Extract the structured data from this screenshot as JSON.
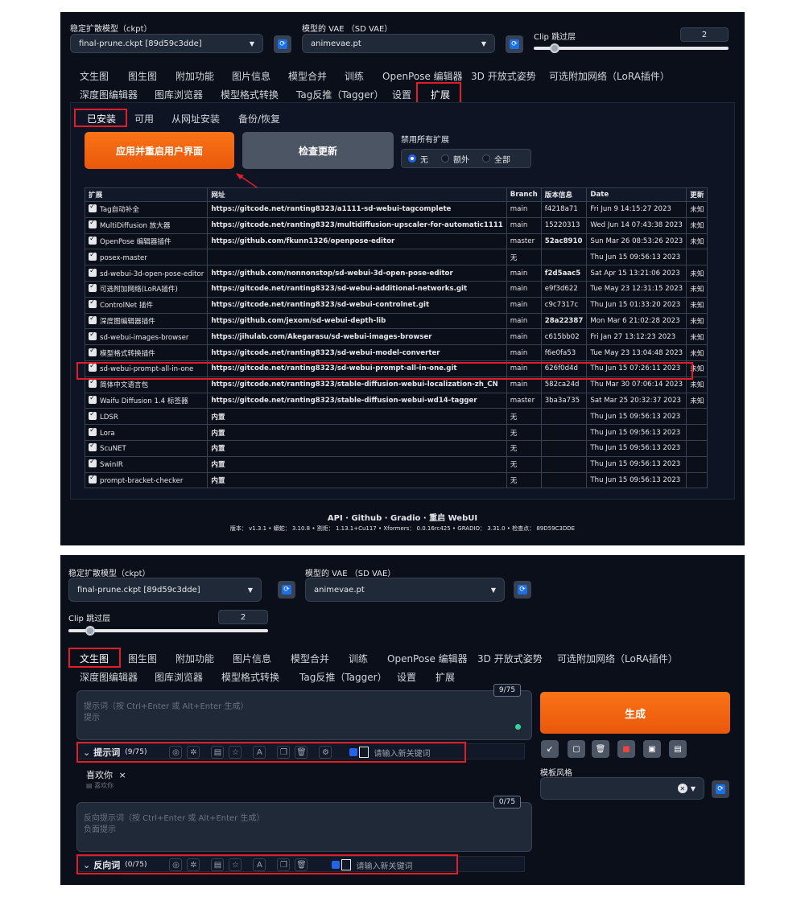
{
  "top": {
    "ckpt_label": "稳定扩散模型（ckpt）",
    "ckpt_value": "final-prune.ckpt [89d59c3dde]",
    "vae_label": "模型的 VAE （SD VAE）",
    "vae_value": "animevae.pt",
    "clip_label": "Clip 跳过层",
    "clip_value": "2",
    "clip_fraction": 0.08
  },
  "tabs_row1": [
    "文生图",
    "图生图",
    "附加功能",
    "图片信息",
    "模型合并",
    "训练",
    "OpenPose 编辑器",
    "3D 开放式姿势",
    "可选附加网络（LoRA插件）"
  ],
  "tabs_row2": [
    "深度图编辑器",
    "图库浏览器",
    "模型格式转换",
    "Tag反推（Tagger）",
    "设置",
    "扩展"
  ],
  "ext_subtabs": [
    "已安装",
    "可用",
    "从网址安装",
    "备份/恢复"
  ],
  "ext_buttons": {
    "apply": "应用并重启用户界面",
    "check": "检查更新"
  },
  "disable_all": {
    "label": "禁用所有扩展",
    "options": [
      "无",
      "额外",
      "全部"
    ],
    "selected": 0
  },
  "table": {
    "headers": [
      "扩展",
      "网址",
      "Branch",
      "版本信息",
      "Date",
      "更新"
    ],
    "rows": [
      [
        "Tag自动补全",
        "https://gitcode.net/ranting8323/a1111-sd-webui-tagcomplete",
        "main",
        "f4218a71",
        "Fri Jun 9 14:15:27 2023",
        "未知"
      ],
      [
        "MultiDiffusion 放大器",
        "https://gitcode.net/ranting8323/multidiffusion-upscaler-for-automatic1111",
        "main",
        "15220313",
        "Wed Jun 14 07:43:38 2023",
        "未知"
      ],
      [
        "OpenPose 编辑器插件",
        "https://github.com/fkunn1326/openpose-editor",
        "master",
        "52ac8910",
        "Sun Mar 26 08:53:26 2023",
        "未知"
      ],
      [
        "posex-master",
        "",
        "无",
        "",
        "Thu Jun 15 09:56:13 2023",
        ""
      ],
      [
        "sd-webui-3d-open-pose-editor",
        "https://github.com/nonnonstop/sd-webui-3d-open-pose-editor",
        "main",
        "f2d5aac5",
        "Sat Apr 15 13:21:06 2023",
        "未知"
      ],
      [
        "可选附加网络(LoRA插件)",
        "https://gitcode.net/ranting8323/sd-webui-additional-networks.git",
        "main",
        "e9f3d622",
        "Tue May 23 12:31:15 2023",
        "未知"
      ],
      [
        "ControlNet 插件",
        "https://gitcode.net/ranting8323/sd-webui-controlnet.git",
        "main",
        "c9c7317c",
        "Thu Jun 15 01:33:20 2023",
        "未知"
      ],
      [
        "深度图编辑器插件",
        "https://github.com/jexom/sd-webui-depth-lib",
        "main",
        "28a22387",
        "Mon Mar 6 21:02:28 2023",
        "未知"
      ],
      [
        "sd-webui-images-browser",
        "https://jihulab.com/Akegarasu/sd-webui-images-browser",
        "main",
        "c615bb02",
        "Fri Jan 27 13:12:23 2023",
        "未知"
      ],
      [
        "模型格式转换插件",
        "https://gitcode.net/ranting8323/sd-webui-model-converter",
        "main",
        "f6e0fa53",
        "Tue May 23 13:04:48 2023",
        "未知"
      ],
      [
        "sd-webui-prompt-all-in-one",
        "https://gitcode.net/ranting8323/sd-webui-prompt-all-in-one.git",
        "main",
        "626f0d4d",
        "Thu Jun 15 07:26:11 2023",
        "未知"
      ],
      [
        "简体中文语言包",
        "https://gitcode.net/ranting8323/stable-diffusion-webui-localization-zh_CN",
        "main",
        "582ca24d",
        "Thu Mar 30 07:06:14 2023",
        "未知"
      ],
      [
        "Waifu Diffusion 1.4 标签器",
        "https://gitcode.net/ranting8323/stable-diffusion-webui-wd14-tagger",
        "master",
        "3ba3a735",
        "Sat Mar 25 20:32:37 2023",
        "未知"
      ],
      [
        "LDSR",
        "内置",
        "无",
        "",
        "Thu Jun 15 09:56:13 2023",
        ""
      ],
      [
        "Lora",
        "内置",
        "无",
        "",
        "Thu Jun 15 09:56:13 2023",
        ""
      ],
      [
        "ScuNET",
        "内置",
        "无",
        "",
        "Thu Jun 15 09:56:13 2023",
        ""
      ],
      [
        "SwinIR",
        "内置",
        "无",
        "",
        "Thu Jun 15 09:56:13 2023",
        ""
      ],
      [
        "prompt-bracket-checker",
        "内置",
        "无",
        "",
        "Thu Jun 15 09:56:13 2023",
        ""
      ]
    ]
  },
  "footer": {
    "links": "API · Github · Gradio · 重启 WebUI",
    "versions": "版本： v1.3.1 • 蟒蛇： 3.10.8 • 割炬： 1.13.1+Cu117 • Xformers： 0.0.16rc425 • GRADIO： 3.31.0 • 检查点： 89D59C3DDE"
  },
  "txt2img": {
    "prompt_placeholder_1": "提示词（按 Ctrl+Enter 或 Alt+Enter 生成）",
    "prompt_placeholder_2": "提示",
    "prompt_counter": "9/75",
    "generate": "生成",
    "prompt_toolbar_label": "提示词",
    "prompt_toolbar_count": "(9/75)",
    "keyword_placeholder": "请输入新关键词",
    "chip_text": "喜欢你",
    "chip_close": "×",
    "chip_sub": "喜欢你",
    "neg_placeholder_1": "反向提示词（按 Ctrl+Enter 或 Alt+Enter 生成）",
    "neg_placeholder_2": "负面提示",
    "neg_counter": "0/75",
    "neg_toolbar_label": "反向词",
    "neg_toolbar_count": "(0/75)",
    "style_label": "模板风格"
  },
  "colors": {
    "accent": "#f97316",
    "bg": "#0b0f19",
    "highlight": "#e11d2a",
    "link": "#1d6fe5"
  }
}
